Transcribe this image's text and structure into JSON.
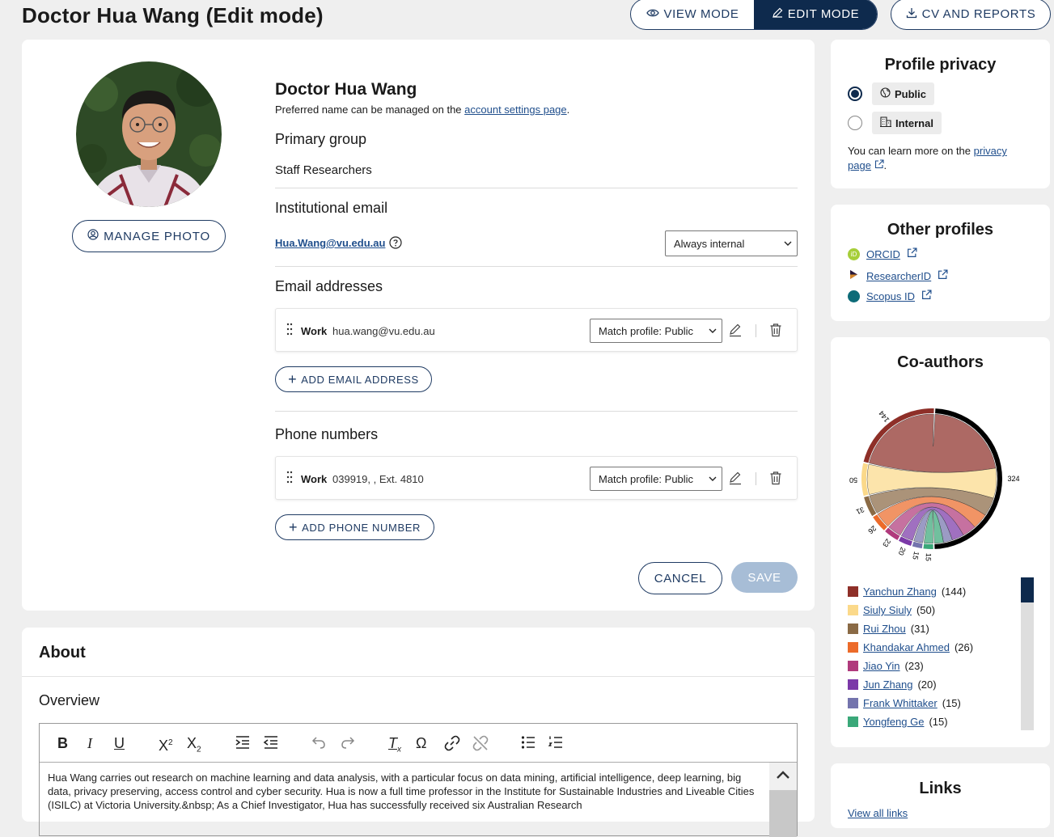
{
  "header": {
    "title": "Doctor Hua Wang (Edit mode)",
    "view_mode": "VIEW MODE",
    "edit_mode": "EDIT MODE",
    "cv_reports": "CV AND REPORTS"
  },
  "profile": {
    "manage_photo": "MANAGE PHOTO",
    "name": "Doctor Hua Wang",
    "preferred_text": "Preferred name can be managed on the ",
    "preferred_link": "account settings page",
    "preferred_end": ".",
    "primary_group_label": "Primary group",
    "primary_group_value": "Staff Researchers",
    "inst_email_label": "Institutional email",
    "inst_email_value": "Hua.Wang@vu.edu.au",
    "inst_email_visibility": "Always internal",
    "email_addresses_label": "Email addresses",
    "email_row": {
      "type": "Work",
      "value": "hua.wang@vu.edu.au",
      "visibility": "Match profile: Public"
    },
    "add_email": "ADD EMAIL ADDRESS",
    "phone_numbers_label": "Phone numbers",
    "phone_row": {
      "type": "Work",
      "value": "039919, , Ext. 4810",
      "visibility": "Match profile: Public"
    },
    "add_phone": "ADD PHONE NUMBER",
    "cancel": "CANCEL",
    "save": "SAVE"
  },
  "privacy": {
    "title": "Profile privacy",
    "options": [
      "Public",
      "Internal"
    ],
    "selected": "Public",
    "learn_text": "You can learn more on the ",
    "learn_link_1": "privacy",
    "learn_link_2": "page",
    "learn_end": "."
  },
  "other_profiles": {
    "title": "Other profiles",
    "items": [
      {
        "label": "ORCID",
        "color": "#a6ce39",
        "mark": "iD"
      },
      {
        "label": "ResearcherID",
        "color": "#5a2d91",
        "mark": ""
      },
      {
        "label": "Scopus ID",
        "color": "#0d6b78",
        "mark": ""
      }
    ]
  },
  "coauthors": {
    "title": "Co-authors",
    "legend": [
      {
        "name": "Yanchun Zhang",
        "count": "(144)",
        "color": "#8e2f28"
      },
      {
        "name": "Siuly Siuly",
        "count": "(50)",
        "color": "#fbd98a"
      },
      {
        "name": "Rui Zhou",
        "count": "(31)",
        "color": "#8a6a45"
      },
      {
        "name": "Khandakar Ahmed",
        "count": "(26)",
        "color": "#ec6b2a"
      },
      {
        "name": "Jiao Yin",
        "count": "(23)",
        "color": "#b03a7c"
      },
      {
        "name": "Jun Zhang",
        "count": "(20)",
        "color": "#7b39a8"
      },
      {
        "name": "Frank Whittaker",
        "count": "(15)",
        "color": "#7474ad"
      },
      {
        "name": "Yongfeng Ge",
        "count": "(15)",
        "color": "#3aa879"
      }
    ],
    "self_total": "324",
    "self_color": "#000000"
  },
  "about": {
    "title": "About",
    "overview": "Overview",
    "text": "Hua Wang carries out research on machine learning and data analysis, with a particular focus on data mining, artificial intelligence, deep learning, big data, privacy preserving, access control and cyber security. Hua is now a full time professor in the Institute for Sustainable Industries and Liveable Cities (ISILC) at Victoria University.&nbsp; As a Chief Investigator, Hua has successfully received six Australian Research"
  },
  "links": {
    "title": "Links",
    "view_all": "View all links"
  }
}
